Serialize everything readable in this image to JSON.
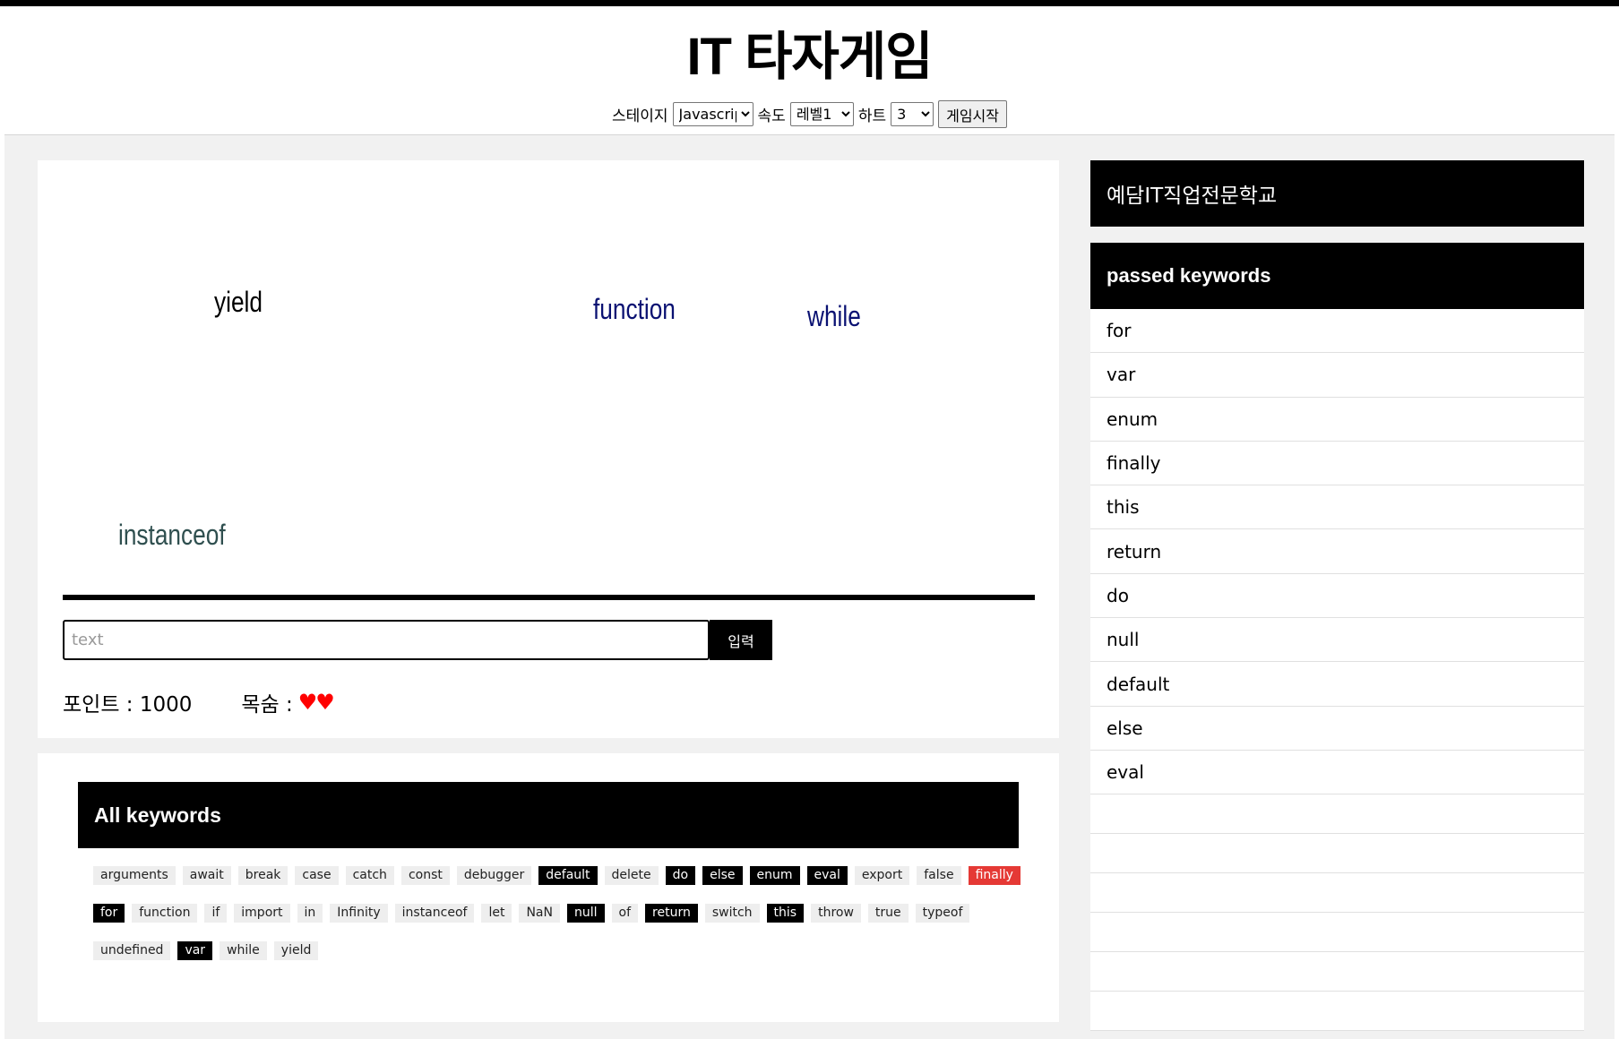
{
  "header": {
    "title": "IT 타자게임",
    "stage_label": "스테이지",
    "stage_value": "Javascript",
    "speed_label": "속도",
    "speed_value": "레벨1",
    "heart_label": "하트",
    "heart_value": "3",
    "start_button": "게임시작"
  },
  "game": {
    "falling_words": [
      {
        "text": "yield",
        "color": "#000000"
      },
      {
        "text": "function",
        "color": "#0a1172"
      },
      {
        "text": "while",
        "color": "#0a1172"
      },
      {
        "text": "instanceof",
        "color": "#2f4f4f"
      }
    ],
    "input_placeholder": "text",
    "submit_label": "입력",
    "points_label": "포인트 : 1000",
    "lives_label": "목숨 :",
    "hearts": "♥♥"
  },
  "all_keywords": {
    "title": "All keywords",
    "items": [
      {
        "text": "arguments",
        "state": "normal"
      },
      {
        "text": "await",
        "state": "normal"
      },
      {
        "text": "break",
        "state": "normal"
      },
      {
        "text": "case",
        "state": "normal"
      },
      {
        "text": "catch",
        "state": "normal"
      },
      {
        "text": "const",
        "state": "normal"
      },
      {
        "text": "debugger",
        "state": "normal"
      },
      {
        "text": "default",
        "state": "passed"
      },
      {
        "text": "delete",
        "state": "normal"
      },
      {
        "text": "do",
        "state": "passed"
      },
      {
        "text": "else",
        "state": "passed"
      },
      {
        "text": "enum",
        "state": "passed"
      },
      {
        "text": "eval",
        "state": "passed"
      },
      {
        "text": "export",
        "state": "normal"
      },
      {
        "text": "false",
        "state": "normal"
      },
      {
        "text": "finally",
        "state": "active"
      },
      {
        "text": "for",
        "state": "passed"
      },
      {
        "text": "function",
        "state": "normal"
      },
      {
        "text": "if",
        "state": "normal"
      },
      {
        "text": "import",
        "state": "normal"
      },
      {
        "text": "in",
        "state": "normal"
      },
      {
        "text": "Infinity",
        "state": "normal"
      },
      {
        "text": "instanceof",
        "state": "normal"
      },
      {
        "text": "let",
        "state": "normal"
      },
      {
        "text": "NaN",
        "state": "normal"
      },
      {
        "text": "null",
        "state": "passed"
      },
      {
        "text": "of",
        "state": "normal"
      },
      {
        "text": "return",
        "state": "passed"
      },
      {
        "text": "switch",
        "state": "normal"
      },
      {
        "text": "this",
        "state": "passed"
      },
      {
        "text": "throw",
        "state": "normal"
      },
      {
        "text": "true",
        "state": "normal"
      },
      {
        "text": "typeof",
        "state": "normal"
      },
      {
        "text": "undefined",
        "state": "normal"
      },
      {
        "text": "var",
        "state": "passed"
      },
      {
        "text": "while",
        "state": "normal"
      },
      {
        "text": "yield",
        "state": "normal"
      }
    ],
    "colors": {
      "passed": "#000000",
      "active": "#e53935",
      "normal": "#eeeeee"
    }
  },
  "sidebar": {
    "school": "예담IT직업전문학교",
    "passed_title": "passed keywords",
    "passed": [
      "for",
      "var",
      "enum",
      "finally",
      "this",
      "return",
      "do",
      "null",
      "default",
      "else",
      "eval"
    ]
  }
}
